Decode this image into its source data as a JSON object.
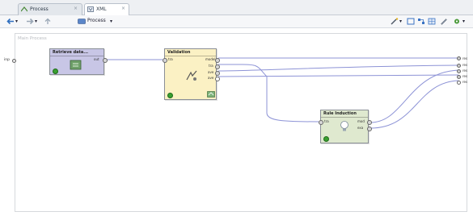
{
  "tabs": [
    {
      "label": "Process",
      "close": "×",
      "icon": "process-icon"
    },
    {
      "label": "XML",
      "close": "×",
      "icon": "xml-icon"
    }
  ],
  "toolbar": {
    "process_label": "Process",
    "dropdown_glyph": "▾",
    "left_icons": [
      "back-arrow-icon",
      "forward-arrow-icon",
      "up-icon",
      "process-nav-icon"
    ],
    "right_icons": [
      "wand-icon",
      "layout-icon",
      "arrange-icon",
      "grid-icon",
      "pencil-icon",
      "settings-icon"
    ]
  },
  "canvas": {
    "label": "Main Process",
    "left_port_label": "inp"
  },
  "operators": [
    {
      "id": "retrieve",
      "title": "Retrieve data...",
      "ports_out": [
        "out"
      ],
      "color": "#c8c6e6"
    },
    {
      "id": "validation",
      "title": "Validation",
      "ports_in": [
        "tra"
      ],
      "ports_out": [
        "model",
        "tra",
        "ave",
        "ave"
      ],
      "color": "#fbf1c4"
    },
    {
      "id": "rule",
      "title": "Rule Induction",
      "ports_in": [
        "tra"
      ],
      "ports_out": [
        "mod",
        "exa"
      ],
      "color": "#dfe9cf"
    }
  ],
  "result_ports": [
    "res",
    "res",
    "res",
    "res",
    "res"
  ],
  "colors": {
    "wire": "#8d93d6",
    "retrieve_fill": "#c8c6e6",
    "validation_fill": "#fbf1c4",
    "rule_fill": "#dfe9cf"
  }
}
